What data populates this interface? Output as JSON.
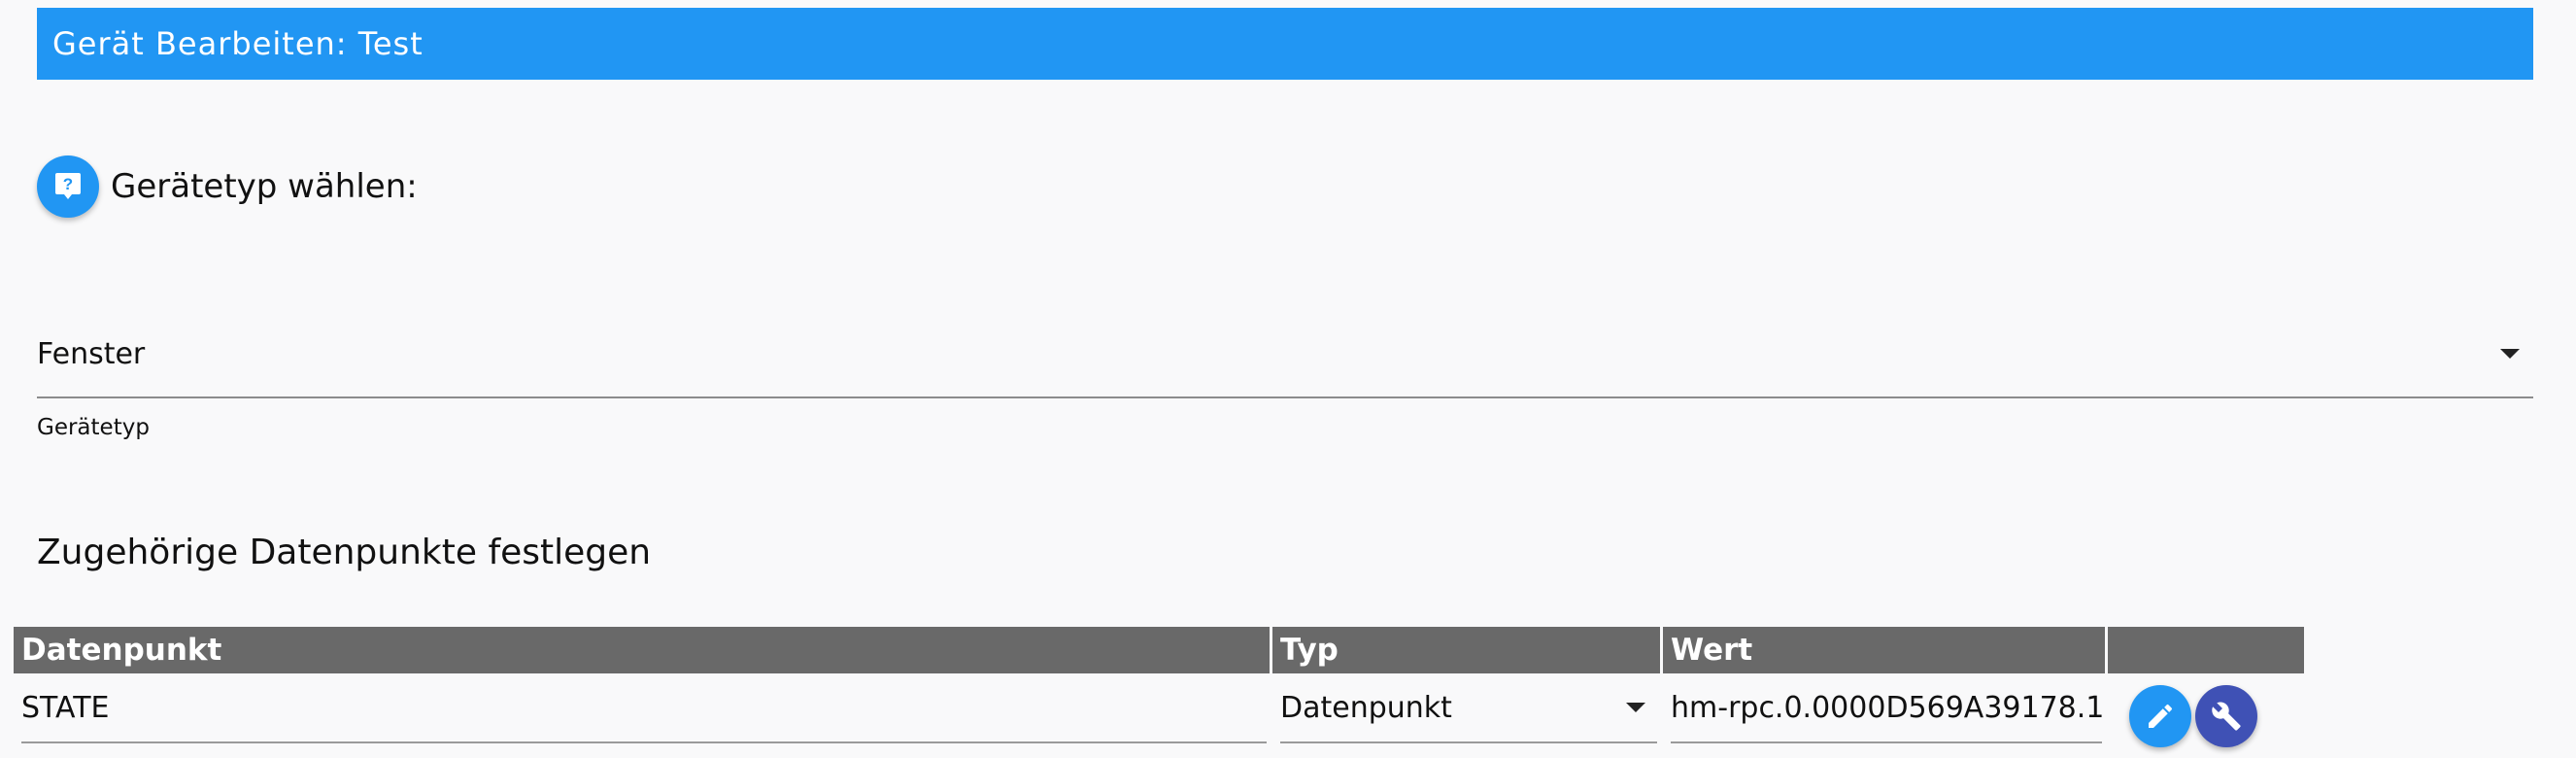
{
  "dialog": {
    "title": "Gerät Bearbeiten: Test"
  },
  "device_type": {
    "help_icon": "help-bubble-icon",
    "heading": "Gerätetyp wählen:",
    "selected": "Fenster",
    "helper_text": "Gerätetyp"
  },
  "datapoints": {
    "section_title": "Zugehörige Datenpunkte festlegen",
    "columns": [
      "Datenpunkt",
      "Typ",
      "Wert",
      ""
    ],
    "rows": [
      {
        "name": "STATE",
        "type": "Datenpunkt",
        "value": "hm-rpc.0.0000D569A39178.1.",
        "actions": [
          "pencil-icon",
          "wrench-icon"
        ]
      }
    ]
  },
  "colors": {
    "primary": "#2196f3",
    "secondary": "#3f51b5",
    "table_header": "#696969"
  }
}
